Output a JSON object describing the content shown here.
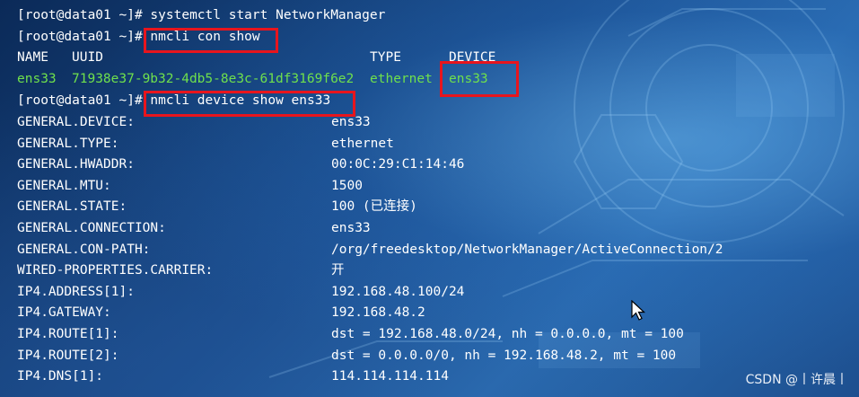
{
  "prompt": "[root@data01 ~]#",
  "commands": {
    "start": " systemctl start NetworkManager",
    "con_show": " nmcli con show",
    "dev_show": " nmcli device show ens33"
  },
  "con_table": {
    "headers": {
      "name": "NAME",
      "uuid": "UUID",
      "type": "TYPE",
      "device": "DEVICE"
    },
    "row": {
      "name": "ens33",
      "uuid": "71938e37-9b32-4db5-8e3c-61df3169f6e2",
      "type": "ethernet",
      "device": "ens33"
    }
  },
  "device_props": [
    {
      "key": "GENERAL.DEVICE:",
      "value": "ens33"
    },
    {
      "key": "GENERAL.TYPE:",
      "value": "ethernet"
    },
    {
      "key": "GENERAL.HWADDR:",
      "value": "00:0C:29:C1:14:46"
    },
    {
      "key": "GENERAL.MTU:",
      "value": "1500"
    },
    {
      "key": "GENERAL.STATE:",
      "value": "100 (已连接)"
    },
    {
      "key": "GENERAL.CONNECTION:",
      "value": "ens33"
    },
    {
      "key": "GENERAL.CON-PATH:",
      "value": "/org/freedesktop/NetworkManager/ActiveConnection/2"
    },
    {
      "key": "WIRED-PROPERTIES.CARRIER:",
      "value": "开"
    },
    {
      "key": "IP4.ADDRESS[1]:",
      "value": "192.168.48.100/24"
    },
    {
      "key": "IP4.GATEWAY:",
      "value": "192.168.48.2"
    },
    {
      "key": "IP4.ROUTE[1]:",
      "value": "dst = 192.168.48.0/24, nh = 0.0.0.0, mt = 100"
    },
    {
      "key": "IP4.ROUTE[2]:",
      "value": "dst = 0.0.0.0/0, nh = 192.168.48.2, mt = 100"
    },
    {
      "key": "IP4.DNS[1]:",
      "value": "114.114.114.114"
    }
  ],
  "watermark": "CSDN @丨许晨丨",
  "colors": {
    "text": "#ffffff",
    "output_green": "#6fe04c",
    "highlight_red": "#e8151d"
  }
}
